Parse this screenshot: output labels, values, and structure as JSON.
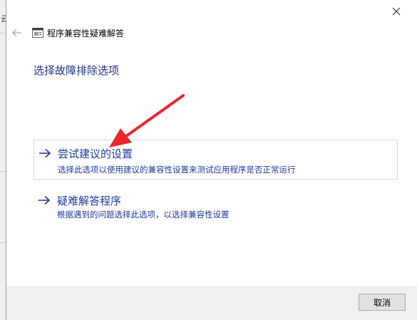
{
  "background_window": {
    "visible_char": "云"
  },
  "window": {
    "title": "程序兼容性疑难解答",
    "close_icon": "close-icon",
    "back_icon": "back-arrow-icon",
    "app_icon": "compatibility-troubleshooter-icon"
  },
  "page": {
    "heading": "选择故障排除选项"
  },
  "options": [
    {
      "title": "尝试建议的设置",
      "description": "选择此选项以使用建议的兼容性设置来测试应用程序是否正常运行",
      "icon": "arrow-right-icon"
    },
    {
      "title": "疑难解答程序",
      "description": "根据遇到的问题选择此选项，以选择兼容性设置",
      "icon": "arrow-right-icon"
    }
  ],
  "footer": {
    "cancel_label": "取消"
  },
  "colors": {
    "link_blue": "#1e3a9c",
    "heading_blue": "#1e3287",
    "annotation_red": "#e8282b",
    "footer_bg": "#f0f0f0"
  }
}
